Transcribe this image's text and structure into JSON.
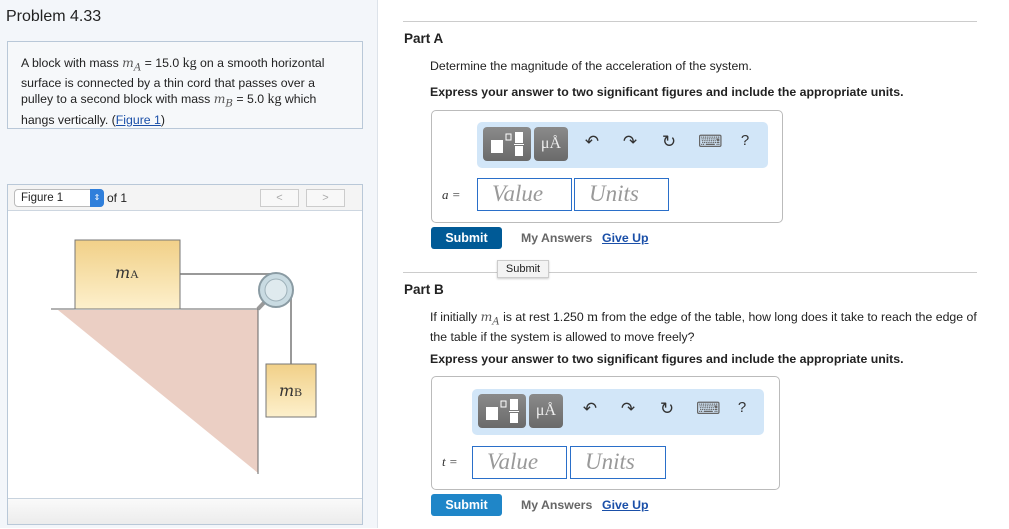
{
  "problem": {
    "title": "Problem 4.33",
    "text_1": "A block with mass ",
    "mA": "m",
    "mA_sub": "A",
    "text_2": " = 15.0 ",
    "kg": "kg",
    "text_3": " on a smooth horizontal surface is connected by a thin cord that passes over a pulley to a second block with mass ",
    "mB": "m",
    "mB_sub": "B",
    "text_4": " = 5.0 ",
    "text_5": " which hangs vertically. (",
    "figure_link": "Figure 1",
    "text_6": ")"
  },
  "figure": {
    "select": "Figure 1",
    "of": "of 1",
    "prev": "<",
    "next": ">",
    "label_a": "m",
    "label_a_sub": "A",
    "label_b": "m",
    "label_b_sub": "B"
  },
  "partA": {
    "title": "Part A",
    "question": "Determine the magnitude of the acceleration of the system.",
    "instruction": "Express your answer to two significant figures and include the appropriate units.",
    "var": "a =",
    "value_placeholder": "Value",
    "units_placeholder": "Units",
    "submit": "Submit",
    "my_answers": "My Answers",
    "give_up": "Give Up",
    "tooltip": "Submit"
  },
  "partB": {
    "title": "Part B",
    "q1": "If initially ",
    "m": "m",
    "m_sub": "A",
    "q2": " is at rest 1.250 ",
    "unit": "m",
    "q3": " from the edge of the table, how long does it take to reach the edge of the table if the system is allowed to move freely?",
    "instruction": "Express your answer to two significant figures and include the appropriate units.",
    "var": "t =",
    "value_placeholder": "Value",
    "units_placeholder": "Units",
    "submit": "Submit",
    "my_answers": "My Answers",
    "give_up": "Give Up"
  },
  "toolbar": {
    "units_btn": "μÅ",
    "help": "?",
    "undo": "↶",
    "redo": "↷",
    "reset": "↻",
    "keyboard": "⌨"
  },
  "colors": {
    "submit_a": "#005a96",
    "submit_b": "#1f86c8",
    "toolbar": "#d2e6f8"
  }
}
